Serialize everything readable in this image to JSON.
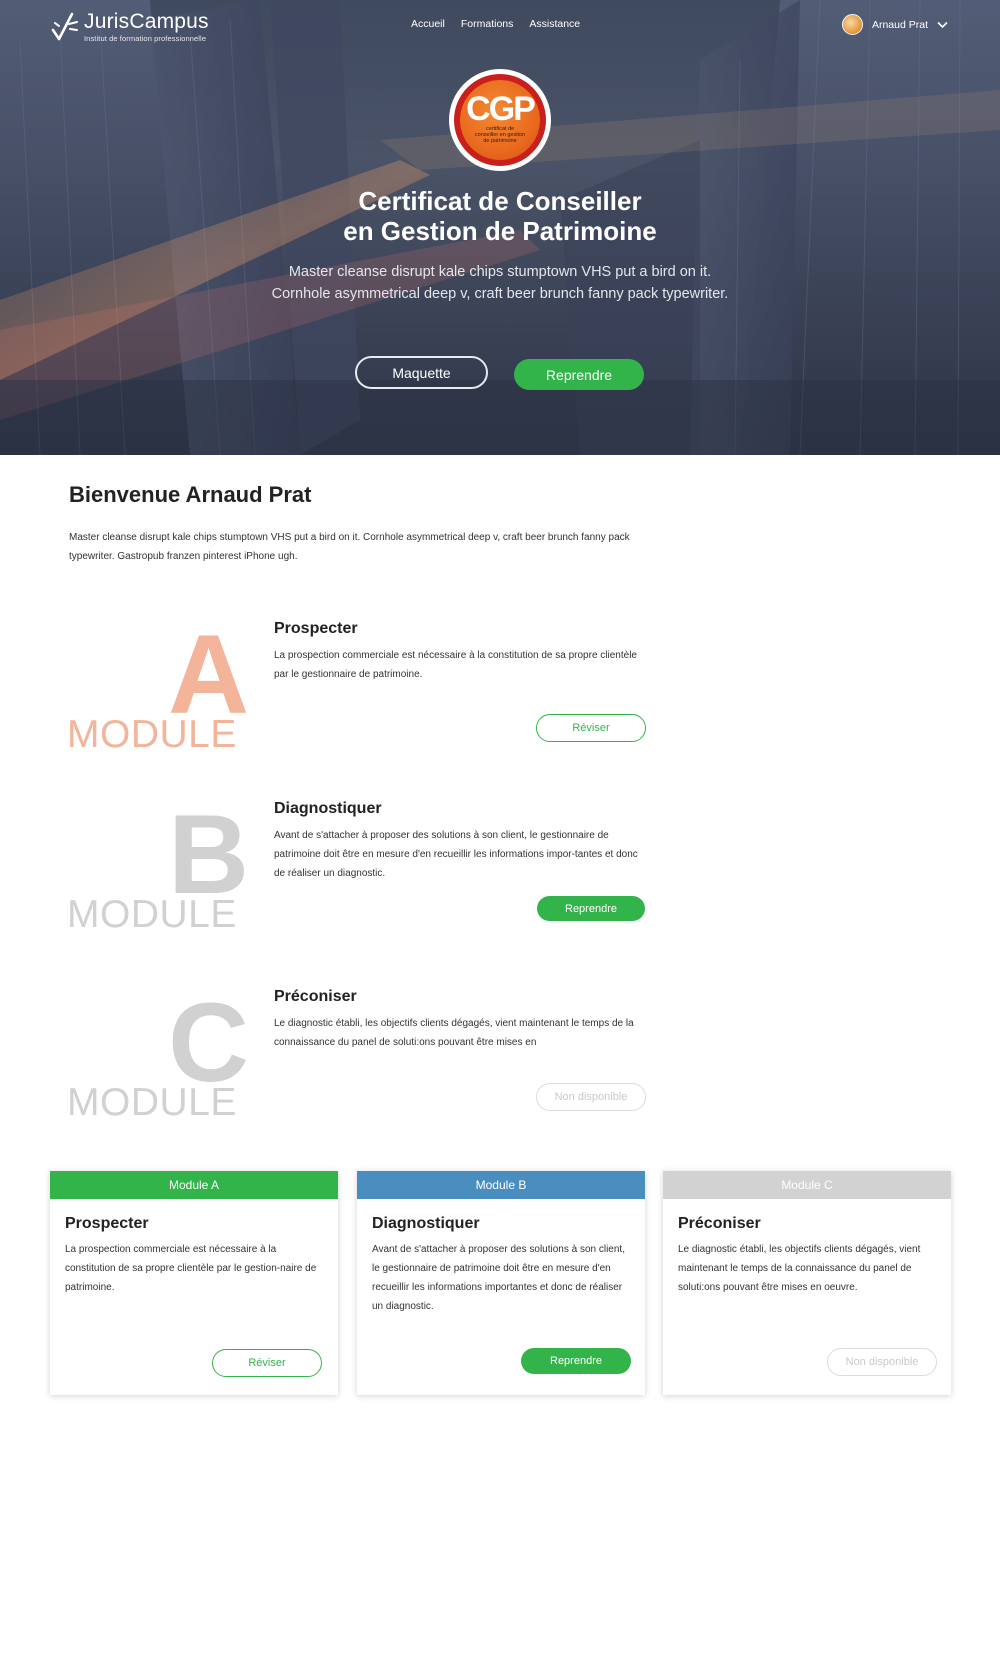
{
  "header": {
    "logo_name": "JurisCampus",
    "logo_subtitle": "Institut de formation professionnelle",
    "nav": [
      "Accueil",
      "Formations",
      "Assistance"
    ],
    "user_name": "Arnaud Prat"
  },
  "hero": {
    "badge_title": "CGP",
    "badge_subtitle": "certificat de conseiller en gestion de patrimoine",
    "title_line1": "Certificat de Conseiller",
    "title_line2": "en Gestion de Patrimoine",
    "text_line1": "Master cleanse disrupt kale chips stumptown VHS put a bird on it.",
    "text_line2": "Cornhole asymmetrical deep v, craft beer brunch fanny pack typewriter.",
    "btn_maquette": "Maquette",
    "btn_reprendre": "Reprendre"
  },
  "welcome": {
    "title": "Bienvenue Arnaud Prat",
    "text": "Master cleanse disrupt kale chips stumptown VHS put a bird on it. Cornhole asymmetrical deep v, craft beer brunch fanny pack typewriter. Gastropub franzen pinterest iPhone ugh."
  },
  "modules": [
    {
      "letter": "A",
      "word": "MODULE",
      "title": "Prospecter",
      "desc": "La prospection commerciale est nécessaire à la constitution de sa propre clientèle par le gestionnaire de patrimoine.",
      "button": "Réviser",
      "color": "#f3b49a"
    },
    {
      "letter": "B",
      "word": "MODULE",
      "title": "Diagnostiquer",
      "desc": "Avant de s'attacher à proposer des solutions à son client, le gestionnaire de patrimoine doit être en mesure d'en recueillir les informations impor-tantes et donc de réaliser un diagnostic.",
      "button": "Reprendre",
      "color": "#d1d1d1"
    },
    {
      "letter": "C",
      "word": "MODULE",
      "title": "Préconiser",
      "desc": "Le diagnostic établi, les objectifs clients dégagés, vient maintenant le temps de la connaissance du panel de soluti:ons pouvant être mises en",
      "button": "Non disponible",
      "color": "#d1d1d1"
    }
  ],
  "cards": [
    {
      "header": "Module A",
      "title": "Prospecter",
      "desc": "La prospection commerciale est nécessaire à la constitution de sa propre clientèle par le gestion-naire de patrimoine.",
      "button": "Réviser",
      "color": "#33b44a"
    },
    {
      "header": "Module B",
      "title": "Diagnostiquer",
      "desc": "Avant de s'attacher à proposer des solutions à son client, le gestionnaire de patrimoine doit être en mesure d'en recueillir les informations importantes et donc de réaliser un diagnostic.",
      "button": "Reprendre",
      "color": "#4a8ec0"
    },
    {
      "header": "Module C",
      "title": "Préconiser",
      "desc": "Le diagnostic établi, les objectifs clients dégagés, vient maintenant le temps de la connaissance du panel de soluti:ons pouvant être mises en oeuvre.",
      "button": "Non disponible",
      "color": "#d2d2d2"
    }
  ]
}
